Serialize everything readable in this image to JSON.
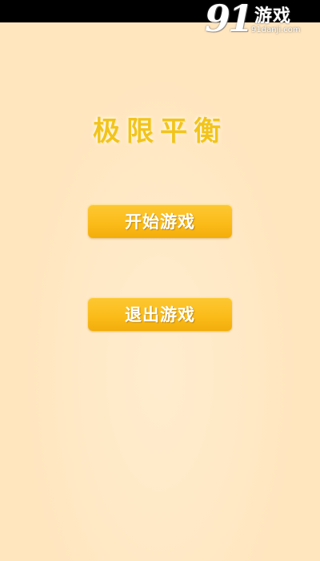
{
  "watermark": {
    "number": "91",
    "name": "游戏",
    "url": "91danji.com"
  },
  "title": "极限平衡",
  "menu": {
    "start_label": "开始游戏",
    "exit_label": "退出游戏"
  },
  "colors": {
    "background": "#ffe6bf",
    "title": "#f2c41b",
    "button": "#fbbc1a",
    "button_text": "#ffffff",
    "status_bar": "#000000"
  }
}
